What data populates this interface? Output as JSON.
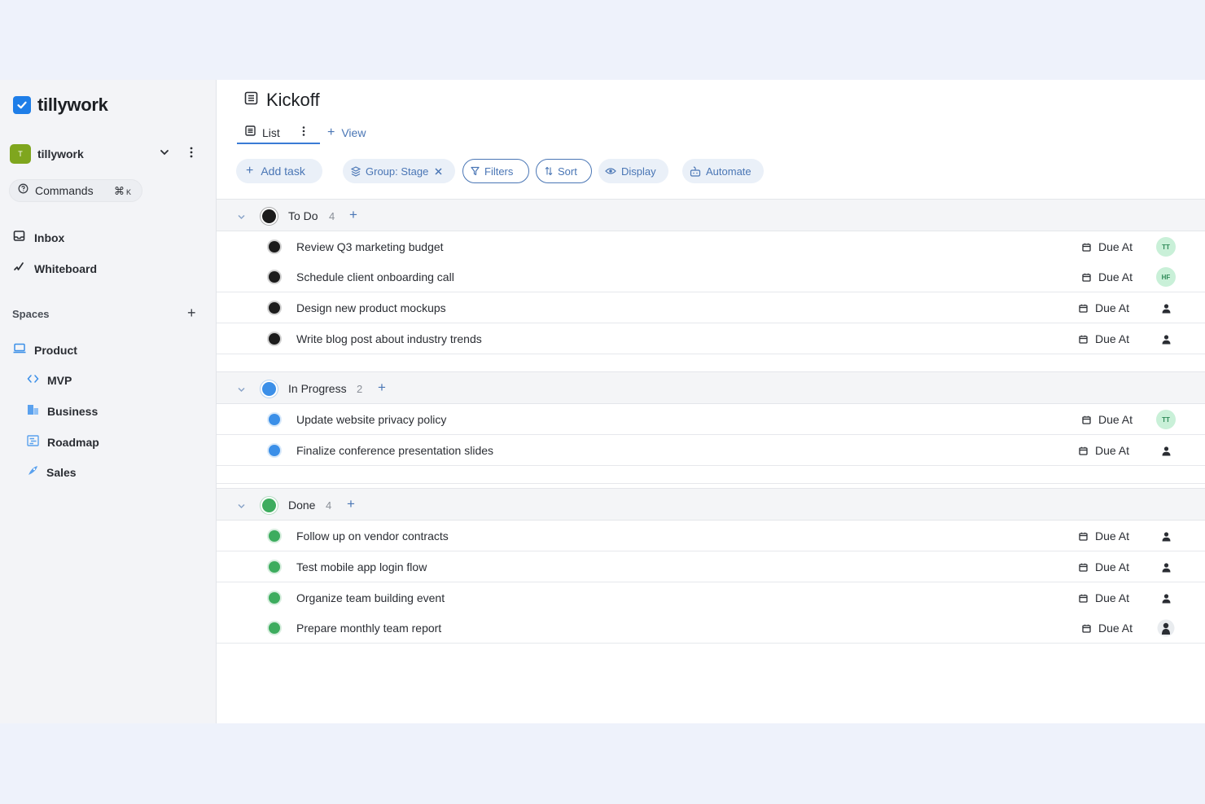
{
  "app": {
    "name": "tillywork"
  },
  "workspace": {
    "initial": "T",
    "name": "tillywork"
  },
  "commands": {
    "label": "Commands",
    "shortcut_key": "⌘",
    "shortcut_letter": "K"
  },
  "nav": [
    {
      "label": "Inbox",
      "icon": "inbox-icon"
    },
    {
      "label": "Whiteboard",
      "icon": "whiteboard-icon"
    }
  ],
  "spaces": {
    "label": "Spaces",
    "items": [
      {
        "label": "Product",
        "icon": "laptop-icon"
      },
      {
        "label": "MVP",
        "icon": "code-icon"
      },
      {
        "label": "Business",
        "icon": "building-icon"
      },
      {
        "label": "Roadmap",
        "icon": "roadmap-icon"
      },
      {
        "label": "Sales",
        "icon": "rocket-icon"
      }
    ]
  },
  "page": {
    "title": "Kickoff",
    "tabs": {
      "list_label": "List",
      "view_label": "View"
    }
  },
  "toolbar": {
    "add_task": "Add task",
    "group": "Group: Stage",
    "filters": "Filters",
    "sort": "Sort",
    "display": "Display",
    "automate": "Automate"
  },
  "colors": {
    "todo": "#1c1c1c",
    "in_progress": "#3b8fe8",
    "done": "#3dac5e",
    "accent": "#4a76b5"
  },
  "groups": [
    {
      "name": "To Do",
      "count": "4",
      "color": "#1c1c1c",
      "tasks": [
        {
          "title": "Review Q3 marketing budget",
          "due": "Due At",
          "assignee": "TT"
        },
        {
          "title": "Schedule client onboarding call",
          "due": "Due At",
          "assignee": "HF"
        },
        {
          "title": "Design new product mockups",
          "due": "Due At",
          "assignee": ""
        },
        {
          "title": "Write blog post about industry trends",
          "due": "Due At",
          "assignee": ""
        }
      ]
    },
    {
      "name": "In Progress",
      "count": "2",
      "color": "#3b8fe8",
      "tasks": [
        {
          "title": "Update website privacy policy",
          "due": "Due At",
          "assignee": "TT"
        },
        {
          "title": "Finalize conference presentation slides",
          "due": "Due At",
          "assignee": ""
        }
      ]
    },
    {
      "name": "Done",
      "count": "4",
      "color": "#3dac5e",
      "tasks": [
        {
          "title": "Follow up on vendor contracts",
          "due": "Due At",
          "assignee": ""
        },
        {
          "title": "Test mobile app login flow",
          "due": "Due At",
          "assignee": ""
        },
        {
          "title": "Organize team building event",
          "due": "Due At",
          "assignee": ""
        },
        {
          "title": "Prepare monthly team report",
          "due": "Due At",
          "assignee": ""
        }
      ]
    }
  ]
}
